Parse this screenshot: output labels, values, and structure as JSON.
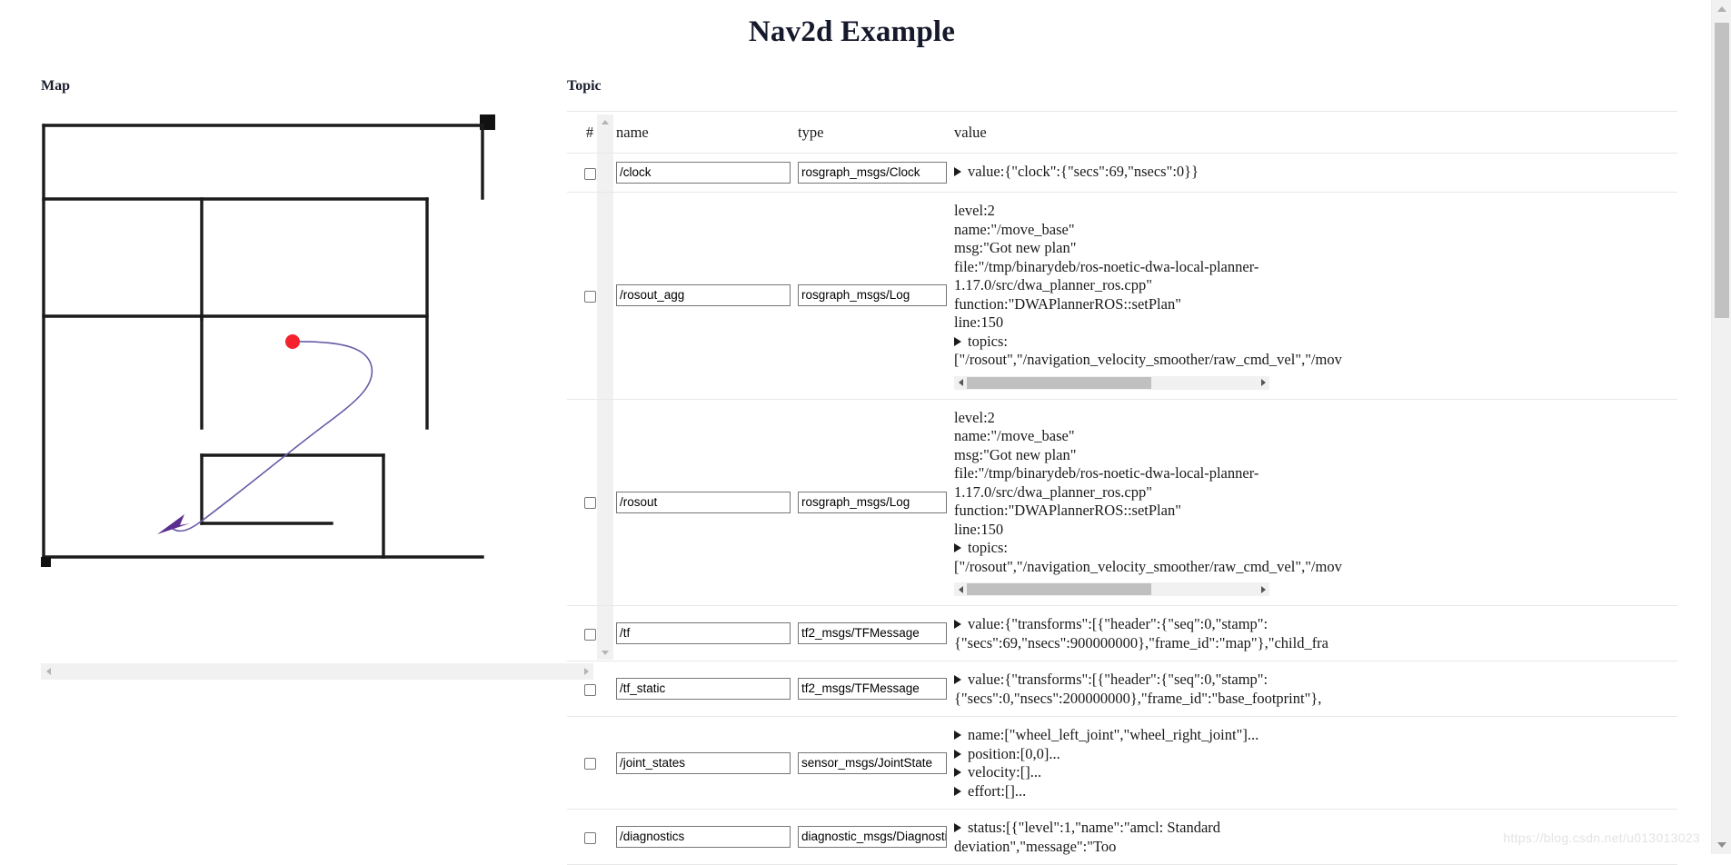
{
  "header": {
    "title": "Nav2d Example"
  },
  "map": {
    "label": "Map",
    "path_color": "#6a5aa8",
    "goal_color": "#f5212d",
    "robot_color": "#5b2d8e",
    "wall_color": "#1b1b1b"
  },
  "topic": {
    "label": "Topic",
    "columns": [
      "#",
      "name",
      "type",
      "value"
    ],
    "rows": [
      {
        "name": "/clock",
        "type": "rosgraph_msgs/Clock",
        "value_lines": [
          {
            "disc": true,
            "text": "value:{\"clock\":{\"secs\":69,\"nsecs\":0}}"
          }
        ],
        "has_scrollbar": false
      },
      {
        "name": "/rosout_agg",
        "type": "rosgraph_msgs/Log",
        "value_lines": [
          {
            "disc": false,
            "text": "level:2"
          },
          {
            "disc": false,
            "text": "name:\"/move_base\""
          },
          {
            "disc": false,
            "text": "msg:\"Got new plan\""
          },
          {
            "disc": false,
            "text": "file:\"/tmp/binarydeb/ros-noetic-dwa-local-planner-"
          },
          {
            "disc": false,
            "text": "1.17.0/src/dwa_planner_ros.cpp\""
          },
          {
            "disc": false,
            "text": "function:\"DWAPlannerROS::setPlan\""
          },
          {
            "disc": false,
            "text": "line:150"
          },
          {
            "disc": true,
            "text": "topics:"
          },
          {
            "disc": false,
            "text": "[\"/rosout\",\"/navigation_velocity_smoother/raw_cmd_vel\",\"/mov"
          }
        ],
        "has_scrollbar": true
      },
      {
        "name": "/rosout",
        "type": "rosgraph_msgs/Log",
        "value_lines": [
          {
            "disc": false,
            "text": "level:2"
          },
          {
            "disc": false,
            "text": "name:\"/move_base\""
          },
          {
            "disc": false,
            "text": "msg:\"Got new plan\""
          },
          {
            "disc": false,
            "text": "file:\"/tmp/binarydeb/ros-noetic-dwa-local-planner-"
          },
          {
            "disc": false,
            "text": "1.17.0/src/dwa_planner_ros.cpp\""
          },
          {
            "disc": false,
            "text": "function:\"DWAPlannerROS::setPlan\""
          },
          {
            "disc": false,
            "text": "line:150"
          },
          {
            "disc": true,
            "text": "topics:"
          },
          {
            "disc": false,
            "text": "[\"/rosout\",\"/navigation_velocity_smoother/raw_cmd_vel\",\"/mov"
          }
        ],
        "has_scrollbar": true
      },
      {
        "name": "/tf",
        "type": "tf2_msgs/TFMessage",
        "value_lines": [
          {
            "disc": true,
            "text": "value:{\"transforms\":[{\"header\":{\"seq\":0,\"stamp\":"
          },
          {
            "disc": false,
            "text": "{\"secs\":69,\"nsecs\":900000000},\"frame_id\":\"map\"},\"child_fra"
          }
        ],
        "has_scrollbar": false
      },
      {
        "name": "/tf_static",
        "type": "tf2_msgs/TFMessage",
        "value_lines": [
          {
            "disc": true,
            "text": "value:{\"transforms\":[{\"header\":{\"seq\":0,\"stamp\":"
          },
          {
            "disc": false,
            "text": "{\"secs\":0,\"nsecs\":200000000},\"frame_id\":\"base_footprint\"},"
          }
        ],
        "has_scrollbar": false
      },
      {
        "name": "/joint_states",
        "type": "sensor_msgs/JointState",
        "value_lines": [
          {
            "disc": true,
            "text": "name:[\"wheel_left_joint\",\"wheel_right_joint\"]..."
          },
          {
            "disc": true,
            "text": "position:[0,0]..."
          },
          {
            "disc": true,
            "text": "velocity:[]..."
          },
          {
            "disc": true,
            "text": "effort:[]..."
          }
        ],
        "has_scrollbar": false
      },
      {
        "name": "/diagnostics",
        "type": "diagnostic_msgs/DiagnosticA",
        "value_lines": [
          {
            "disc": true,
            "text": "status:[{\"level\":1,\"name\":\"amcl: Standard"
          },
          {
            "disc": false,
            "text": "deviation\",\"message\":\"Too"
          }
        ],
        "has_scrollbar": false
      }
    ]
  },
  "watermark": {
    "text": "https://blog.csdn.net/u013013023"
  }
}
